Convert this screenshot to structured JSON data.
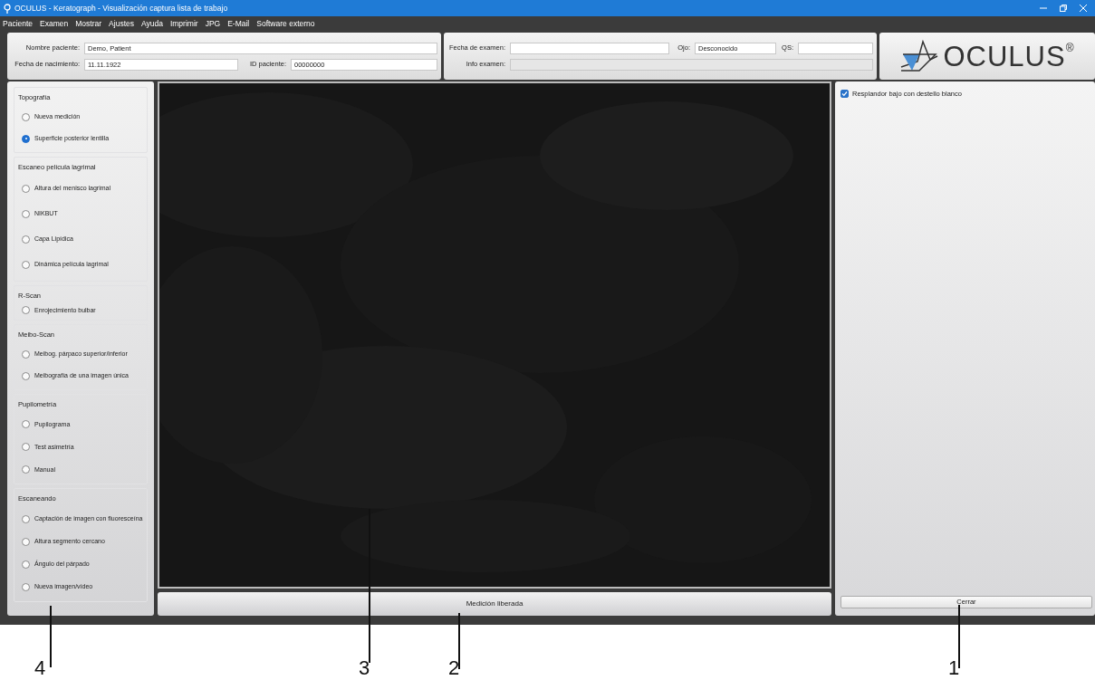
{
  "window": {
    "title": "OCULUS - Keratograph - Visualización captura lista de trabajo"
  },
  "menu": [
    "Paciente",
    "Examen",
    "Mostrar",
    "Ajustes",
    "Ayuda",
    "Imprimir",
    "JPG",
    "E-Mail",
    "Software externo"
  ],
  "patient": {
    "name": {
      "label": "Nombre paciente:",
      "value": "Demo, Patient"
    },
    "birth": {
      "label": "Fecha de nacimiento:",
      "value": "11.11.1922"
    },
    "id": {
      "label": "ID paciente:",
      "value": "00000000"
    }
  },
  "exam": {
    "date": {
      "label": "Fecha de examen:",
      "disabled": false
    },
    "eye": {
      "label": "Ojo:",
      "value": "Desconocido",
      "disabled": false
    },
    "qs": {
      "label": "QS:",
      "disabled": false
    },
    "info": {
      "label": "Info examen:",
      "disabled": true
    }
  },
  "logo": "OCULUS$^{®}$",
  "sidebar": {
    "groups": [
      {
        "title": "Topografía",
        "options": [
          {
            "label": "Nueva medición",
            "selected": false
          },
          {
            "label": "Superficie posterior lentilla",
            "selected": true
          }
        ]
      },
      {
        "title": "Escaneo película lagrimal",
        "options": [
          {
            "label": "Altura del menisco lagrimal",
            "selected": false
          },
          {
            "label": "NIKBUT",
            "selected": false
          },
          {
            "label": "Capa Lipídica",
            "selected": false
          },
          {
            "label": "Dinámica película lagrimal",
            "selected": false
          }
        ]
      },
      {
        "title": "R-Scan",
        "options": [
          {
            "label": "Enrojecimiento bulbar",
            "selected": false
          }
        ]
      },
      {
        "title": "Meibo-Scan",
        "options": [
          {
            "label": "Meibog. párpaco superior/inferior",
            "selected": false
          },
          {
            "label": "Meibografía de una imagen única",
            "selected": false
          }
        ]
      },
      {
        "title": "Pupilometría",
        "options": [
          {
            "label": "Pupilograma",
            "selected": false
          },
          {
            "label": "Test asimetría",
            "selected": false
          },
          {
            "label": "Manual",
            "selected": false
          }
        ]
      },
      {
        "title": "Escaneando",
        "options": [
          {
            "label": "Captación de imagen con fluoresceína",
            "selected": false
          },
          {
            "label": "Altura segmento cercano",
            "selected": false
          },
          {
            "label": "Ángulo del párpado",
            "selected": false
          },
          {
            "label": "Nueva imagen/vídeo",
            "selected": false
          }
        ]
      }
    ]
  },
  "status_bar": "Medición liberada",
  "right_panel": {
    "checkbox": {
      "label": "Resplandor bajo con destello blanco",
      "checked": true
    },
    "close_button": "Cerrar"
  },
  "callouts": [
    "4",
    "3",
    "2",
    "1"
  ]
}
